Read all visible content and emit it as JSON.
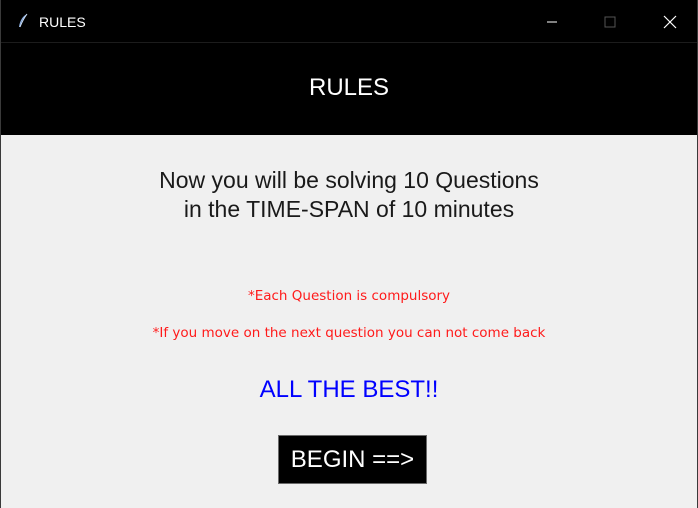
{
  "window": {
    "title": "RULES",
    "icon": "feather-icon"
  },
  "header": {
    "title": "RULES"
  },
  "content": {
    "intro": "Now you will be solving 10 Questions\n in the TIME-SPAN of 10 minutes",
    "rules": [
      "*Each Question is compulsory",
      "*If you move on the next question you can not come back"
    ],
    "best_wishes": "ALL THE BEST!!",
    "begin_label": "BEGIN ==>"
  },
  "colors": {
    "header_bg": "#000000",
    "body_bg": "#f0f0f0",
    "rule_text": "#ff1a1a",
    "best_text": "#0000ff"
  }
}
